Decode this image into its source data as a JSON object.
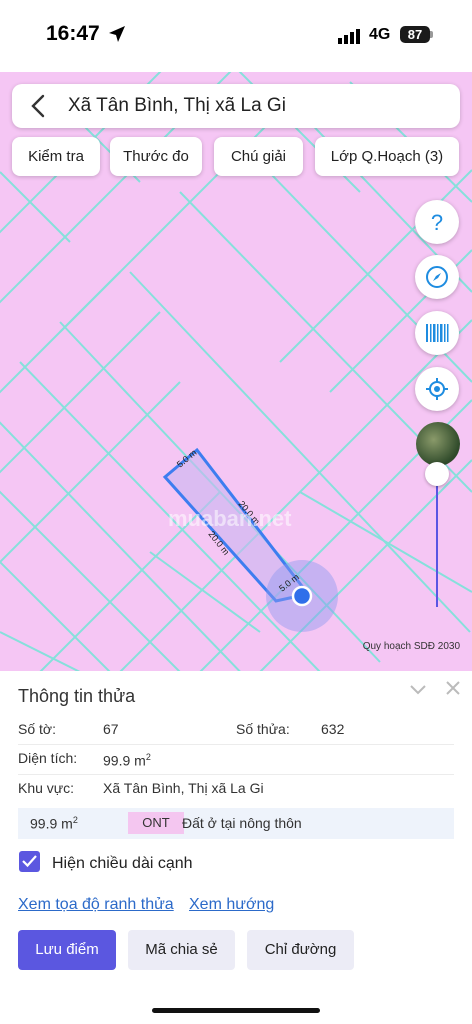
{
  "status_bar": {
    "time": "16:47",
    "network": "4G",
    "battery": "87"
  },
  "search": {
    "title": "Xã Tân Bình, Thị xã La Gi"
  },
  "toolbar": {
    "chips": [
      "Kiểm tra",
      "Thước đo",
      "Chú giải",
      "Lớp Q.Hoạch (3)"
    ]
  },
  "map": {
    "caption": "Quy hoạch SDĐ 2030",
    "watermark": "muaban.net",
    "dimension_labels": {
      "top": "5.0 m",
      "right_upper": "20.0 m",
      "left_long": "20.0 m",
      "bottom": "5.0 m"
    },
    "land_color": "#f5c6f4",
    "line_color": "#7be3d9",
    "parcel_color": "#3d7df0",
    "slider_level": 0.1
  },
  "panel": {
    "title": "Thông tin thửa",
    "so_to_label": "Số tờ:",
    "so_to_value": "67",
    "so_thua_label": "Số thửa:",
    "so_thua_value": "632",
    "dien_tich_label": "Diện tích:",
    "dien_tich_value": "99.9 m",
    "dien_tich_unit_sup": "2",
    "khu_vuc_label": "Khu vực:",
    "khu_vuc_value": "Xã Tân Bình, Thị xã La Gi",
    "zone_area": "99.9 m",
    "zone_area_sup": "2",
    "zone_code": "ONT",
    "zone_name": "Đất ở tại nông thôn",
    "checkbox_label": "Hiện chiều dài cạnh",
    "checkbox_checked": true,
    "link_coords": "Xem tọa độ ranh thửa",
    "link_direction": "Xem hướng",
    "btn_save": "Lưu điểm",
    "btn_share": "Mã chia sẻ",
    "btn_directions": "Chỉ đường"
  },
  "accent_color": "#5b57e0"
}
